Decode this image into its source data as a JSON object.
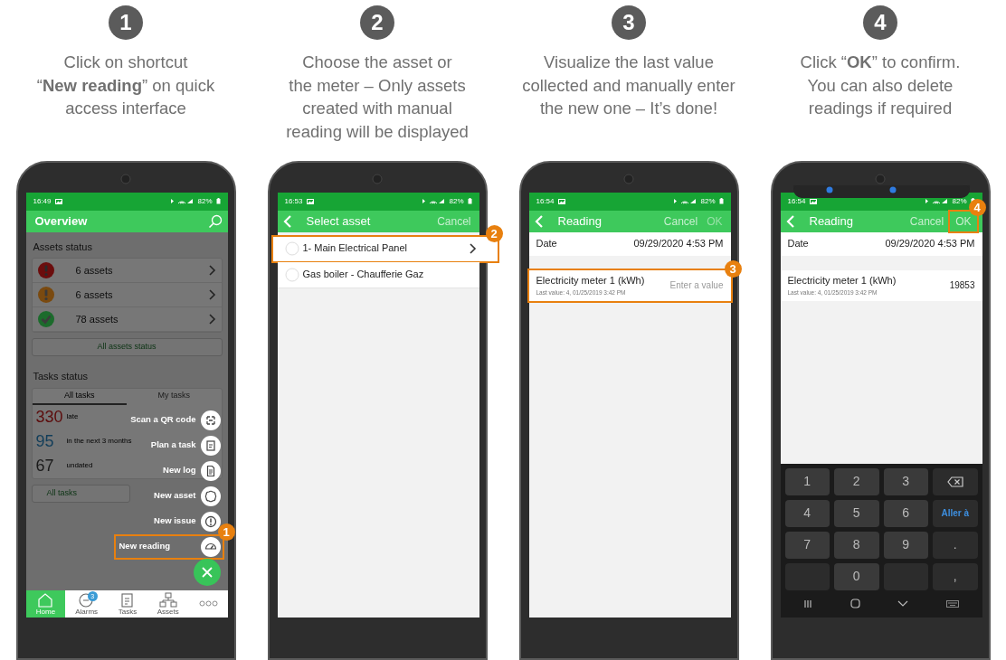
{
  "steps": [
    {
      "number": "1",
      "caption": "Click on shortcut\n“**New reading**” on quick\naccess interface",
      "screen": {
        "kind": "overview",
        "time": "16:49",
        "battery": "82%",
        "title": "Overview",
        "assets_section": "Assets status",
        "asset_rows": [
          {
            "kind": "critical",
            "label": "6 assets"
          },
          {
            "kind": "warning",
            "label": "6 assets"
          },
          {
            "kind": "ok",
            "label": "78 assets"
          }
        ],
        "assets_button": "All assets status",
        "tasks_section": "Tasks status",
        "task_tabs": [
          {
            "label": "All tasks",
            "selected": true
          },
          {
            "label": "My tasks",
            "selected": false
          }
        ],
        "task_rows": [
          {
            "count": "330",
            "label": "late",
            "color": "#5c0c0c"
          },
          {
            "count": "95",
            "label": "in the next 3 months",
            "color": "#123e5a"
          },
          {
            "count": "67",
            "label": "undated",
            "color": "#1a1a1a"
          }
        ],
        "tasks_button": "All tasks",
        "menu": [
          {
            "kind": "qr",
            "label": "Scan a QR code"
          },
          {
            "kind": "plan",
            "label": "Plan a task"
          },
          {
            "kind": "log",
            "label": "New log"
          },
          {
            "kind": "asset",
            "label": "New asset"
          },
          {
            "kind": "issue",
            "label": "New issue"
          },
          {
            "kind": "reading",
            "label": "New reading",
            "callout": "1"
          }
        ],
        "nav": [
          {
            "kind": "home",
            "label": "Home",
            "selected": true
          },
          {
            "kind": "alarms",
            "label": "Alarms",
            "selected": false,
            "badge": "3"
          },
          {
            "kind": "tasks",
            "label": "Tasks",
            "selected": false
          },
          {
            "kind": "assets",
            "label": "Assets",
            "selected": false
          },
          {
            "kind": "more",
            "selected": false
          }
        ]
      }
    },
    {
      "number": "2",
      "caption": "Choose the asset or\nthe meter – Only assets\ncreated with manual\nreading will be displayed",
      "screen": {
        "kind": "select",
        "time": "16:53",
        "battery": "82%",
        "title": "Select asset",
        "actions": [
          {
            "label": "Cancel",
            "disabled": false
          }
        ],
        "items": [
          {
            "label": "1- Main Electrical Panel",
            "selected": false,
            "has_children": true,
            "callout": "2"
          },
          {
            "label": "Gas boiler - Chaufferie Gaz",
            "selected": false,
            "has_children": false
          }
        ]
      }
    },
    {
      "number": "3",
      "caption": "Visualize the last value\ncollected and manually enter\nthe new one – It’s done!",
      "screen": {
        "kind": "reading",
        "time": "16:54",
        "battery": "82%",
        "title": "Reading",
        "actions": [
          {
            "label": "Cancel",
            "disabled": false
          },
          {
            "label": "OK",
            "disabled": true
          }
        ],
        "date_label": "Date",
        "date_value": "09/29/2020 4:53 PM",
        "meter": {
          "name": "Electricity meter 1 (kWh)",
          "last_value": "Last value: 4, 01/25/2019 3:42 PM",
          "placeholder": "Enter a value",
          "callout": "3"
        }
      }
    },
    {
      "number": "4",
      "caption": "Click “**OK**” to confirm.\nYou can also delete\nreadings if required",
      "screen": {
        "kind": "reading",
        "time": "16:54",
        "battery": "82%",
        "title": "Reading",
        "notification_peek": true,
        "actions": [
          {
            "label": "Cancel",
            "disabled": false
          },
          {
            "label": "OK",
            "disabled": false,
            "callout": "4"
          }
        ],
        "date_label": "Date",
        "date_value": "09/29/2020 4:53 PM",
        "meter": {
          "name": "Electricity meter 1 (kWh)",
          "last_value": "Last value: 4, 01/25/2019 3:42 PM",
          "value": "19853"
        },
        "keyboard": [
          {
            "kind": "digit",
            "label": "1"
          },
          {
            "kind": "digit",
            "label": "2"
          },
          {
            "kind": "digit",
            "label": "3"
          },
          {
            "kind": "backspace"
          },
          {
            "kind": "digit",
            "label": "4"
          },
          {
            "kind": "digit",
            "label": "5"
          },
          {
            "kind": "digit",
            "label": "6"
          },
          {
            "kind": "action",
            "label": "Aller à"
          },
          {
            "kind": "digit",
            "label": "7"
          },
          {
            "kind": "digit",
            "label": "8"
          },
          {
            "kind": "digit",
            "label": "9"
          },
          {
            "kind": "symbol",
            "label": "."
          },
          {
            "kind": "blank"
          },
          {
            "kind": "digit",
            "label": "0"
          },
          {
            "kind": "blank"
          },
          {
            "kind": "symbol",
            "label": ","
          }
        ]
      }
    }
  ]
}
